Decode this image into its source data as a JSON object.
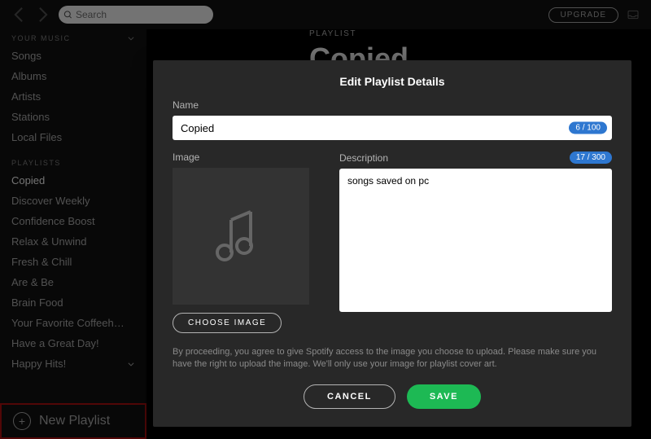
{
  "topbar": {
    "search_placeholder": "Search",
    "upgrade_label": "UPGRADE"
  },
  "sidebar": {
    "your_music_header": "YOUR MUSIC",
    "your_music": [
      "Songs",
      "Albums",
      "Artists",
      "Stations",
      "Local Files"
    ],
    "playlists_header": "PLAYLISTS",
    "playlists": [
      "Copied",
      "Discover Weekly",
      "Confidence Boost",
      "Relax & Unwind",
      "Fresh & Chill",
      "Are & Be",
      "Brain Food",
      "Your Favorite Coffeeh…",
      "Have a Great Day!",
      "Happy Hits!"
    ],
    "new_playlist_label": "New Playlist"
  },
  "main": {
    "playlist_label": "PLAYLIST",
    "playlist_title_bg": "Copied"
  },
  "modal": {
    "title": "Edit Playlist Details",
    "name_label": "Name",
    "name_value": "Copied",
    "name_counter": "6 / 100",
    "image_label": "Image",
    "choose_image_label": "CHOOSE IMAGE",
    "description_label": "Description",
    "description_counter": "17 / 300",
    "description_value": "songs saved on pc",
    "legal_text": "By proceeding, you agree to give Spotify access to the image you choose to upload. Please make sure you have the right to upload the image. We'll only use your image for playlist cover art.",
    "cancel_label": "CANCEL",
    "save_label": "SAVE"
  }
}
